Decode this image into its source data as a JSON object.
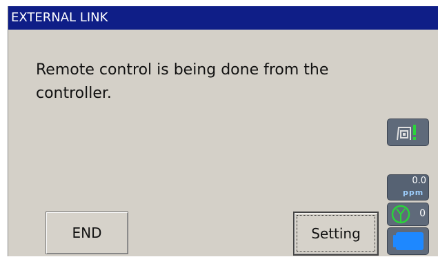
{
  "window": {
    "title": "EXTERNAL LINK"
  },
  "message": {
    "line1": "Remote control is being done from the",
    "line2": "controller."
  },
  "buttons": {
    "end_label": "END",
    "setting_label": "Setting"
  },
  "status": {
    "link_icon": "external-link-icon",
    "ppm_value": "0.0",
    "ppm_unit": "ppm",
    "prism_value": "0",
    "prism_icon": "prism-icon",
    "battery_icon": "battery-icon"
  },
  "colors": {
    "title_bar": "#0f1e87",
    "background": "#d4d0c8",
    "indicator_green": "#2ad43a",
    "battery_blue": "#1e88ff"
  }
}
